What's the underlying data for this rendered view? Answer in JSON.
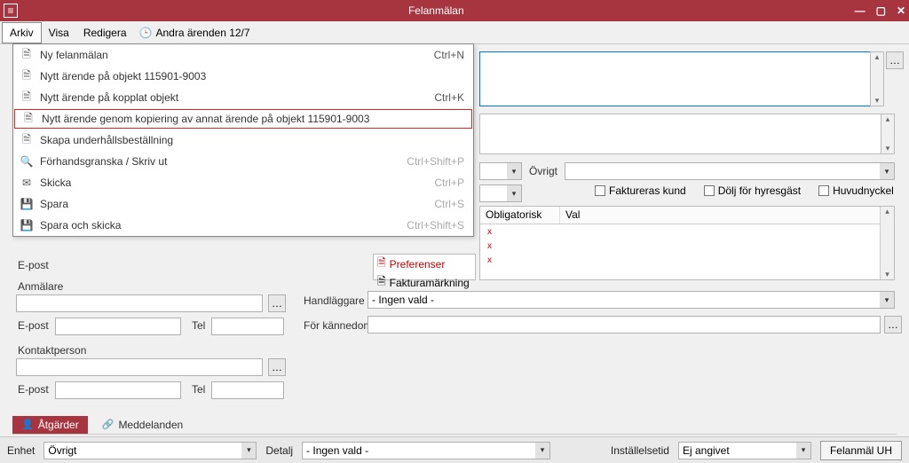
{
  "window": {
    "title": "Felanmälan"
  },
  "menubar": {
    "arkiv": "Arkiv",
    "visa": "Visa",
    "redigera": "Redigera",
    "andra": "Andra ärenden 12/7"
  },
  "arkiv_menu": {
    "ny": "Ny felanmälan",
    "ny_short": "Ctrl+N",
    "nytt_objekt": "Nytt ärende på objekt 115901-9003",
    "nytt_kopplat": "Nytt ärende på kopplat objekt",
    "nytt_kopplat_short": "Ctrl+K",
    "kopiera": "Nytt ärende genom kopiering av annat ärende på objekt 115901-9003",
    "underhall": "Skapa underhållsbeställning",
    "forhand": "Förhandsgranska / Skriv ut",
    "forhand_short": "Ctrl+Shift+P",
    "skicka": "Skicka",
    "skicka_short": "Ctrl+P",
    "spara": "Spara",
    "spara_short": "Ctrl+S",
    "spara_skicka": "Spara och skicka",
    "spara_skicka_short": "Ctrl+Shift+S"
  },
  "labels": {
    "ovrigt": "Övrigt",
    "faktureras": "Faktureras kund",
    "dolj": "Dölj för hyresgäst",
    "huvudnyckel": "Huvudnyckel",
    "obligatorisk": "Obligatorisk",
    "val": "Val",
    "preferenser": "Preferenser",
    "fakturamarkning": "Fakturamärkning",
    "epost": "E-post",
    "anmalare": "Anmälare",
    "tel": "Tel",
    "kontaktperson": "Kontaktperson",
    "handlaggare": "Handläggare",
    "for_kannedom": "För kännedom",
    "atgarder": "Åtgärder",
    "meddelanden": "Meddelanden",
    "enhet": "Enhet",
    "detalj": "Detalj",
    "installelsetid": "Inställelsetid",
    "felanmal_uh": "Felanmäl UH"
  },
  "values": {
    "handlaggare": "- Ingen vald -",
    "enhet_ddl": "Övrigt",
    "detalj_ddl": "- Ingen vald -",
    "installelsetid_ddl": "Ej angivet",
    "x": "x"
  }
}
